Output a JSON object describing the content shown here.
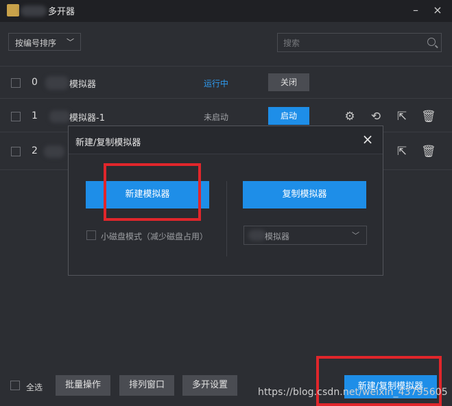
{
  "app": {
    "title": "多开器",
    "close_symbol": "×"
  },
  "toolbar": {
    "sort_label": "按编号排序",
    "search_placeholder": "搜索"
  },
  "list": {
    "rows": [
      {
        "index": "0",
        "name": "模拟器",
        "status": "运行中",
        "status_color": "#2e9bf0",
        "action": "关闭"
      },
      {
        "index": "1",
        "name": "模拟器-1",
        "status": "未启动",
        "status_color": "#a0a2a6",
        "action": "启动"
      },
      {
        "index": "2",
        "name": "",
        "status": "",
        "status_color": "#a0a2a6",
        "action": ""
      }
    ]
  },
  "dialog": {
    "title": "新建/复制模拟器",
    "new_button": "新建模拟器",
    "copy_button": "复制模拟器",
    "small_disk_label": "小磁盘模式（减少磁盘占用）",
    "copy_source_value": "模拟器"
  },
  "footer": {
    "select_all": "全选",
    "batch": "批量操作",
    "arrange": "排列窗口",
    "settings": "多开设置",
    "new_copy": "新建/复制模拟器",
    "watermark": "https://blog.csdn.net/weixin_43795605"
  },
  "colors": {
    "accent": "#1e8ee8",
    "highlight_box": "#e0262b"
  }
}
